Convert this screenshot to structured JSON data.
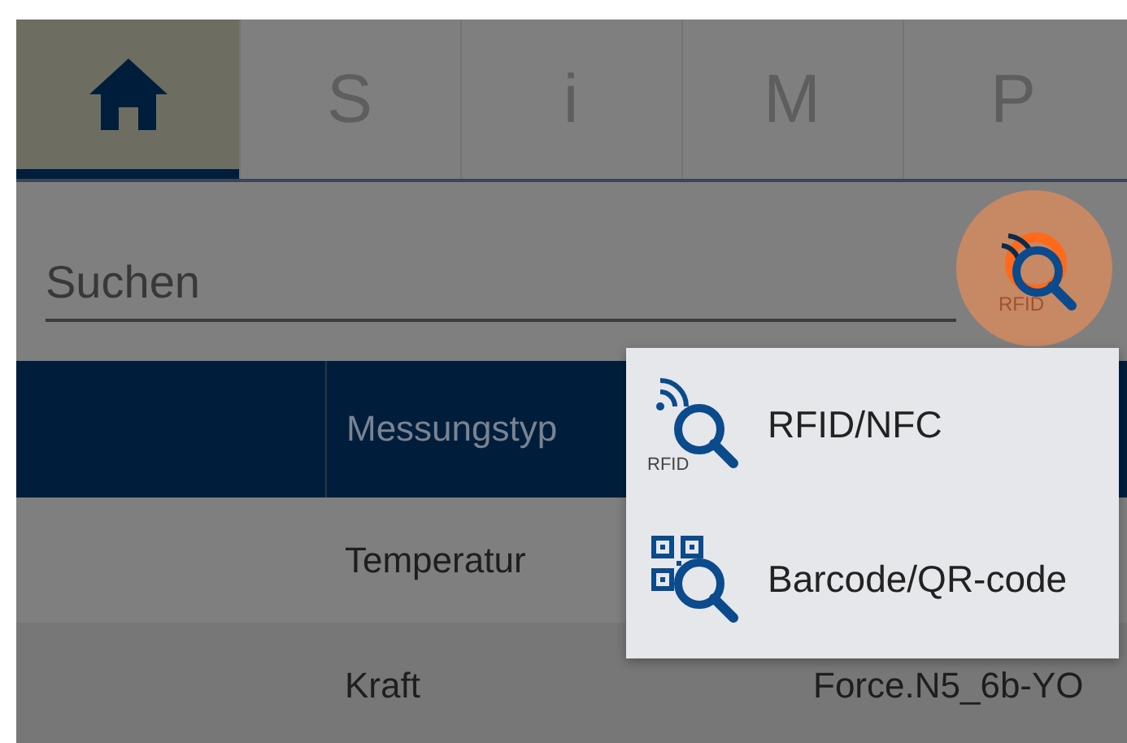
{
  "tabs": [
    {
      "kind": "home",
      "selected": true
    },
    {
      "kind": "letter",
      "label": "S",
      "selected": false
    },
    {
      "kind": "letter",
      "label": "i",
      "selected": false
    },
    {
      "kind": "letter",
      "label": "M",
      "selected": false
    },
    {
      "kind": "letter",
      "label": "P",
      "selected": false
    }
  ],
  "search": {
    "placeholder": "Suchen",
    "scan_button": {
      "badge": "RFID"
    }
  },
  "table": {
    "columns": [
      "Messungstyp"
    ],
    "rows": [
      {
        "cells": [
          "Temperatur"
        ]
      },
      {
        "cells": [
          "Kraft",
          "Force.N5_6b-YO"
        ]
      }
    ]
  },
  "scan_menu": [
    {
      "kind": "rfid",
      "badge": "RFID",
      "label": "RFID/NFC"
    },
    {
      "kind": "qr",
      "label": "Barcode/QR-code"
    }
  ]
}
